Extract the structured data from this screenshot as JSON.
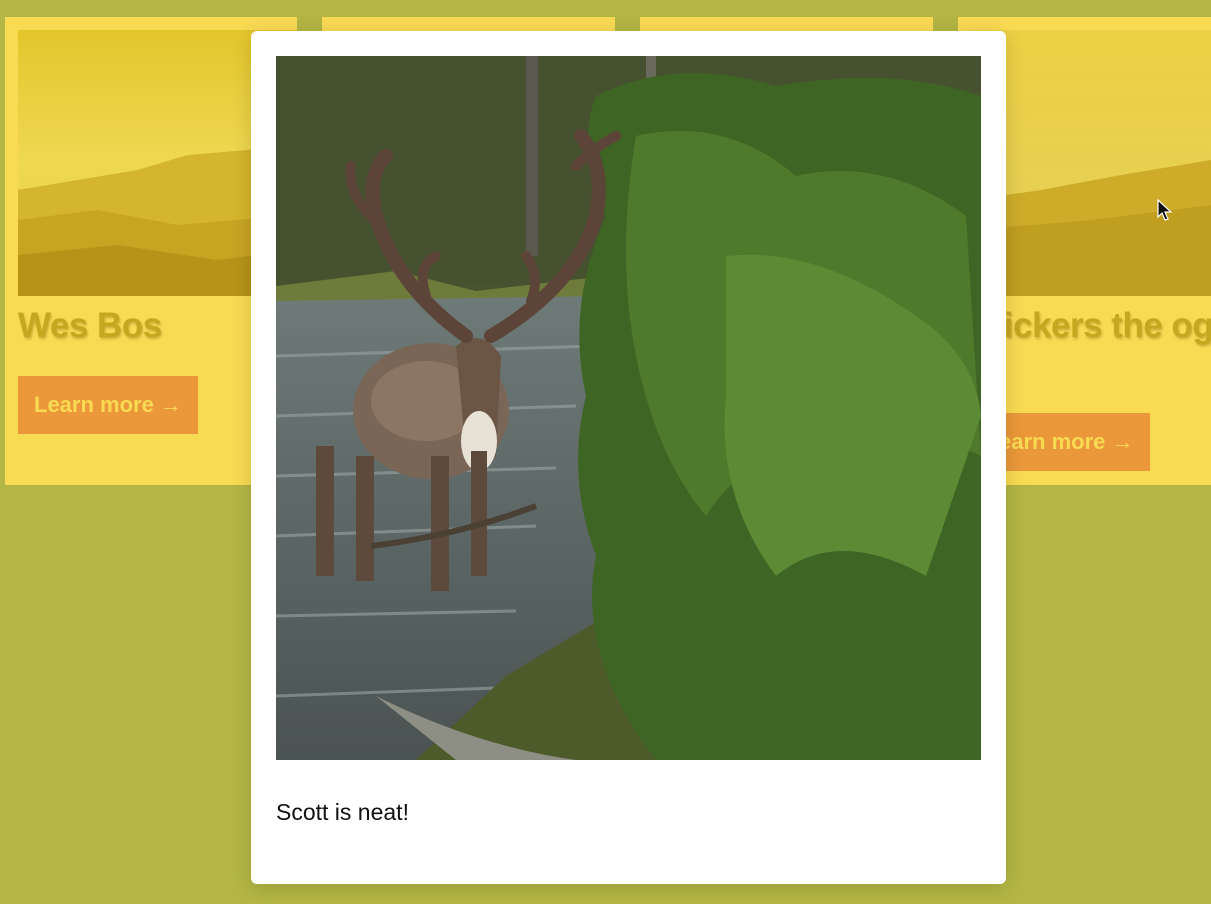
{
  "page": {
    "background_color": "#b3b644"
  },
  "cards": [
    {
      "title": "Wes Bos",
      "button_label": "Learn more →"
    },
    {
      "title": "",
      "button_label": ""
    },
    {
      "title": "",
      "button_label": ""
    },
    {
      "title": "nickers the og",
      "button_label": "earn more →"
    }
  ],
  "colors": {
    "card_background": "#ffdd55",
    "title_text": "#c9a51e",
    "button_background": "#f0963a",
    "button_text": "#ffdd55",
    "modal_background": "#ffffff"
  },
  "modal": {
    "image_icon": "reindeer-photo",
    "caption": "Scott is neat!"
  },
  "cursor": {
    "icon": "mouse-pointer-icon"
  }
}
